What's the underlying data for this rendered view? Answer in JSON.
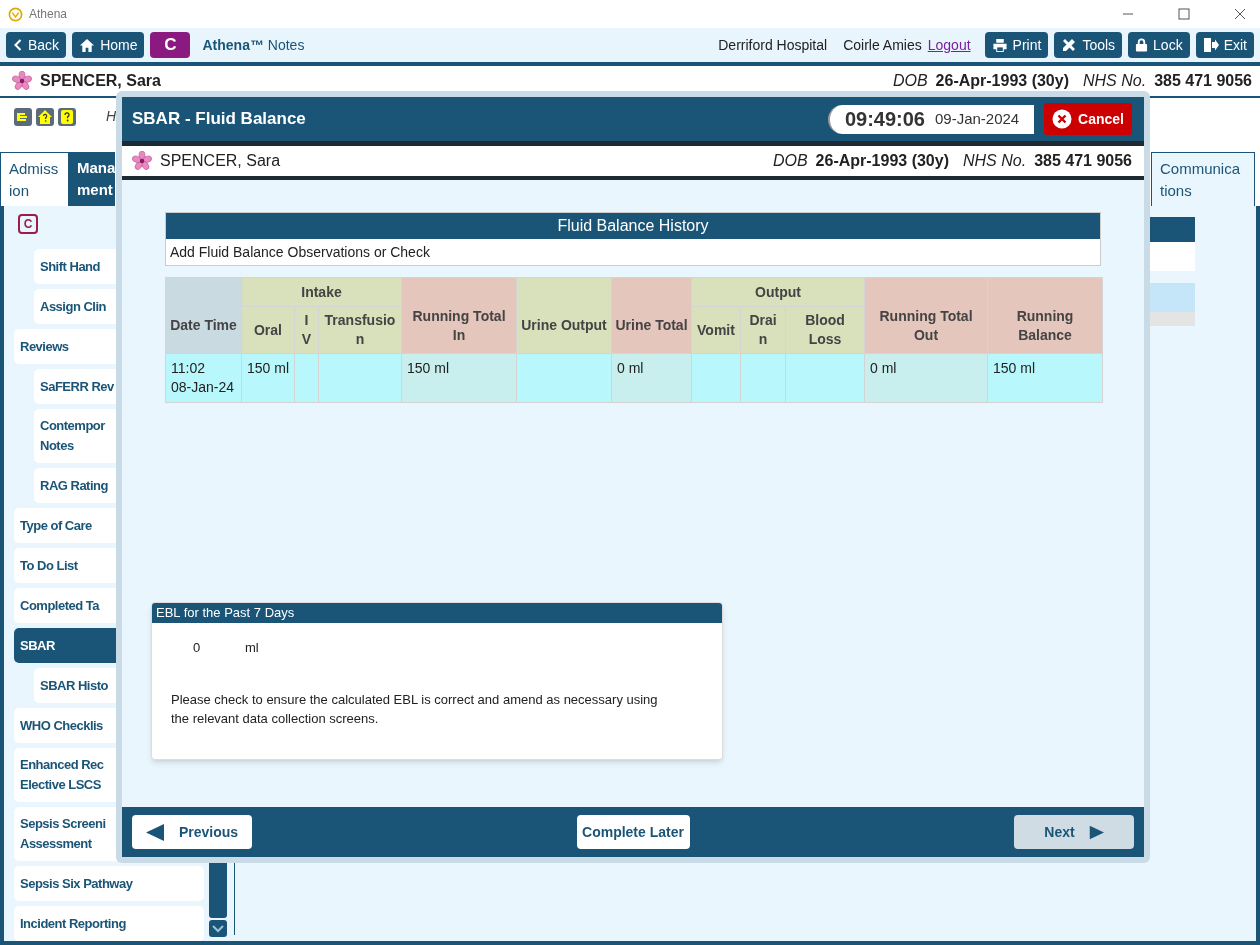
{
  "window": {
    "title": "Athena"
  },
  "toolbar": {
    "nav": [
      {
        "label": "Back",
        "kind": "back"
      },
      {
        "label": "Home",
        "kind": "home"
      }
    ],
    "badge": "C",
    "app_name": "**Athena™** Notes",
    "location": "Derriford Hospital",
    "user": "Coirle Amies",
    "logout": "Logout",
    "actions": [
      {
        "label": "Print",
        "kind": "print"
      },
      {
        "label": "Tools",
        "kind": "tools"
      },
      {
        "label": "Lock",
        "kind": "lock"
      },
      {
        "label": "Exit",
        "kind": "exit"
      }
    ]
  },
  "patient": {
    "name": "SPENCER, Sara",
    "dob_label": "DOB",
    "dob": "26-Apr-1993 (30y)",
    "nhs_label": "NHS No.",
    "nhs": "385 471 9056"
  },
  "alert_icons": [
    {
      "kind": "hand"
    },
    {
      "kind": "home"
    },
    {
      "kind": "note"
    }
  ],
  "header_text": "H",
  "tabs": [
    {
      "label": "Admiss\nion",
      "selected": false
    },
    {
      "label": "Mana\nment",
      "selected": true
    }
  ],
  "tabs_right": [
    {
      "label": "Communica\ntions",
      "selected": false
    }
  ],
  "sidebar": {
    "badge": "C",
    "items_continued": [
      {
        "label": "Shift Hand",
        "selected": false
      },
      {
        "label": "Assign Clin",
        "selected": false
      }
    ],
    "items": [
      {
        "label": "Reviews",
        "selected": false,
        "children": [
          {
            "label": "SaFERR Rev",
            "selected": false
          },
          {
            "label": "Contempor\nNotes",
            "selected": false
          },
          {
            "label": "RAG Rating",
            "selected": false
          }
        ]
      },
      {
        "label": "Type of Care",
        "selected": false
      },
      {
        "label": "To Do List",
        "selected": false
      },
      {
        "label": "Completed Ta",
        "selected": false
      },
      {
        "label": "SBAR",
        "selected": true,
        "children": [
          {
            "label": "SBAR Histo",
            "selected": false
          }
        ]
      },
      {
        "label": "WHO Checklis",
        "selected": false
      },
      {
        "label": "Enhanced Rec\nElective LSCS",
        "selected": false
      },
      {
        "label": "Sepsis Screeni\nAssessment",
        "selected": false
      },
      {
        "label": "Sepsis Six Pathway",
        "selected": false
      },
      {
        "label": "Incident Reporting",
        "selected": false
      }
    ]
  },
  "dialog": {
    "title": "SBAR - Fluid Balance",
    "time": "09:49:06",
    "date": "09-Jan-2024",
    "cancel": "Cancel",
    "patient": {
      "name": "SPENCER, Sara",
      "dob_label": "DOB",
      "dob": "26-Apr-1993 (30y)",
      "nhs_label": "NHS No.",
      "nhs": "385 471 9056"
    },
    "history": {
      "title": "Fluid Balance History",
      "action": "Add Fluid Balance Observations or Check"
    },
    "table": {
      "columns": [
        {
          "label": "Date Time",
          "kind": "key"
        },
        {
          "label": "Oral",
          "kind": "measure",
          "group": {
            "label": "Intake"
          }
        },
        {
          "label": "I\nV",
          "kind": "measure",
          "grouped": true
        },
        {
          "label": "Transfusio\nn",
          "kind": "measure",
          "grouped": true
        },
        {
          "label": "Running Total\nIn",
          "kind": "total"
        },
        {
          "label": "Urine Output",
          "kind": "measure"
        },
        {
          "label": "Urine Total",
          "kind": "total"
        },
        {
          "label": "Vomit",
          "kind": "measure",
          "group": {
            "label": "Output"
          }
        },
        {
          "label": "Drai\nn",
          "kind": "measure",
          "grouped": true
        },
        {
          "label": "Blood\nLoss",
          "kind": "measure",
          "grouped": true
        },
        {
          "label": "Running Total\nOut",
          "kind": "total"
        },
        {
          "label": "Running\nBalance",
          "kind": "balance"
        }
      ],
      "rows": [
        {
          "cells": [
            "11:02\n08-Jan-24",
            "150 ml",
            "",
            "",
            "150 ml",
            "",
            "0 ml",
            "",
            "",
            "",
            "0 ml",
            "150 ml"
          ]
        }
      ]
    },
    "ebl": {
      "title": "EBL for the Past 7 Days",
      "value": "0",
      "unit": "ml",
      "note": "Please check to ensure the calculated EBL is correct and amend as necessary using\nthe relevant data collection screens."
    },
    "footer": {
      "previous": {
        "label": "Previous",
        "disabled": false
      },
      "complete_later": {
        "label": "Complete Later",
        "disabled": false
      },
      "next": {
        "label": "Next",
        "disabled": true
      }
    }
  }
}
